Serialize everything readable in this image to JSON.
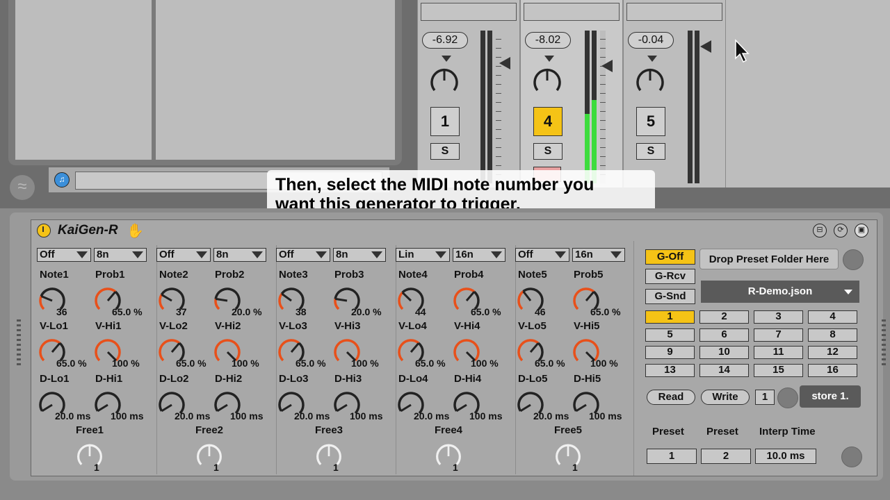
{
  "mixer": {
    "tracks": [
      {
        "volume": "-6.92",
        "number": "1",
        "solo": "S",
        "selected": false
      },
      {
        "volume": "-8.02",
        "number": "4",
        "solo": "S",
        "selected": true
      },
      {
        "volume": "-0.04",
        "number": "5",
        "solo": "S",
        "selected": false
      }
    ]
  },
  "caption": {
    "line1": "Then, select the MIDI note number you",
    "line2": "want this generator to trigger."
  },
  "device": {
    "title": "KaiGen-R",
    "hand_glyph": "✋",
    "columns": [
      {
        "mode": "Off",
        "rate": "8n",
        "note_label": "Note1",
        "prob_label": "Prob1",
        "note_val": "36",
        "prob_val": "65.0 %",
        "vlo_label": "V-Lo1",
        "vhi_label": "V-Hi1",
        "vlo_val": "65.0 %",
        "vhi_val": "100 %",
        "dlo_label": "D-Lo1",
        "dhi_label": "D-Hi1",
        "dlo_val": "20.0 ms",
        "dhi_val": "100 ms",
        "free_label": "Free1",
        "free_val": "1"
      },
      {
        "mode": "Off",
        "rate": "8n",
        "note_label": "Note2",
        "prob_label": "Prob2",
        "note_val": "37",
        "prob_val": "20.0 %",
        "vlo_label": "V-Lo2",
        "vhi_label": "V-Hi2",
        "vlo_val": "65.0 %",
        "vhi_val": "100 %",
        "dlo_label": "D-Lo2",
        "dhi_label": "D-Hi2",
        "dlo_val": "20.0 ms",
        "dhi_val": "100 ms",
        "free_label": "Free2",
        "free_val": "1"
      },
      {
        "mode": "Off",
        "rate": "8n",
        "note_label": "Note3",
        "prob_label": "Prob3",
        "note_val": "38",
        "prob_val": "20.0 %",
        "vlo_label": "V-Lo3",
        "vhi_label": "V-Hi3",
        "vlo_val": "65.0 %",
        "vhi_val": "100 %",
        "dlo_label": "D-Lo3",
        "dhi_label": "D-Hi3",
        "dlo_val": "20.0 ms",
        "dhi_val": "100 ms",
        "free_label": "Free3",
        "free_val": "1"
      },
      {
        "mode": "Lin",
        "rate": "16n",
        "note_label": "Note4",
        "prob_label": "Prob4",
        "note_val": "44",
        "prob_val": "65.0 %",
        "vlo_label": "V-Lo4",
        "vhi_label": "V-Hi4",
        "vlo_val": "65.0 %",
        "vhi_val": "100 %",
        "dlo_label": "D-Lo4",
        "dhi_label": "D-Hi4",
        "dlo_val": "20.0 ms",
        "dhi_val": "100 ms",
        "free_label": "Free4",
        "free_val": "1"
      },
      {
        "mode": "Off",
        "rate": "16n",
        "note_label": "Note5",
        "prob_label": "Prob5",
        "note_val": "46",
        "prob_val": "65.0 %",
        "vlo_label": "V-Lo5",
        "vhi_label": "V-Hi5",
        "vlo_val": "65.0 %",
        "vhi_val": "100 %",
        "dlo_label": "D-Lo5",
        "dhi_label": "D-Hi5",
        "dlo_val": "20.0 ms",
        "dhi_val": "100 ms",
        "free_label": "Free5",
        "free_val": "1"
      }
    ],
    "global": {
      "g_off": "G-Off",
      "g_rcv": "G-Rcv",
      "g_snd": "G-Snd",
      "drop_label": "Drop Preset Folder Here",
      "preset_file": "R-Demo.json",
      "preset_slots": [
        "1",
        "2",
        "3",
        "4",
        "5",
        "6",
        "7",
        "8",
        "9",
        "10",
        "11",
        "12",
        "13",
        "14",
        "15",
        "16"
      ],
      "active_slot": "1",
      "read": "Read",
      "write": "Write",
      "store_num": "1",
      "store": "store 1.",
      "preset_a_label": "Preset",
      "preset_b_label": "Preset",
      "interp_label": "Interp Time",
      "preset_a_val": "1",
      "preset_b_val": "2",
      "interp_val": "10.0 ms"
    }
  },
  "colors": {
    "accent_yellow": "#f5c316",
    "knob_orange": "#e8501a",
    "meter_green": "#3ddc3d",
    "hand_blue": "#3a35e0"
  }
}
